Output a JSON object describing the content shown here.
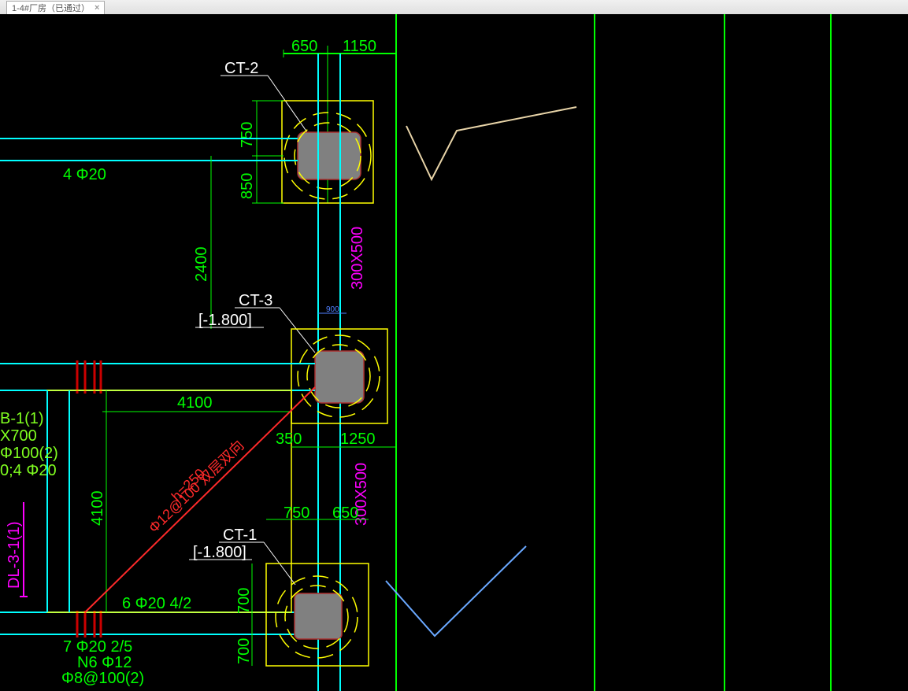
{
  "tab": {
    "title": "1-4#厂房（已通过）"
  },
  "labels": {
    "ct2": "CT-2",
    "ct3": "CT-3",
    "ct3_elev": "[-1.800]",
    "ct1": "CT-1",
    "ct1_elev": "[-1.800]"
  },
  "dims": {
    "d650_top": "650",
    "d1150_top": "1150",
    "d750_v1": "750",
    "d850_v1": "850",
    "d2400_v": "2400",
    "b300x500_a": "300X500",
    "b300x500_b": "300X500",
    "d4100_h": "4100",
    "d350": "350",
    "d1250": "1250",
    "d4100_v": "4100",
    "d750": "750",
    "d650": "650",
    "d700a": "700",
    "d700b": "700",
    "d900": "900"
  },
  "rebar": {
    "r4f20": "4 Φ20",
    "r6f20": "6 Φ20 4/2",
    "r7f20": "7 Φ20 2/5",
    "n6f12": "N6 Φ12",
    "f8at100": "Φ8@100(2)",
    "h250": "h=250",
    "f12at100": "Φ12@100 双层双向"
  },
  "kl": {
    "name": "B-1(1)",
    "size": "X700",
    "stir": "Φ100(2)",
    "bar": "0;4 Φ20"
  },
  "dl": {
    "name": "DL-3-1(1)"
  }
}
